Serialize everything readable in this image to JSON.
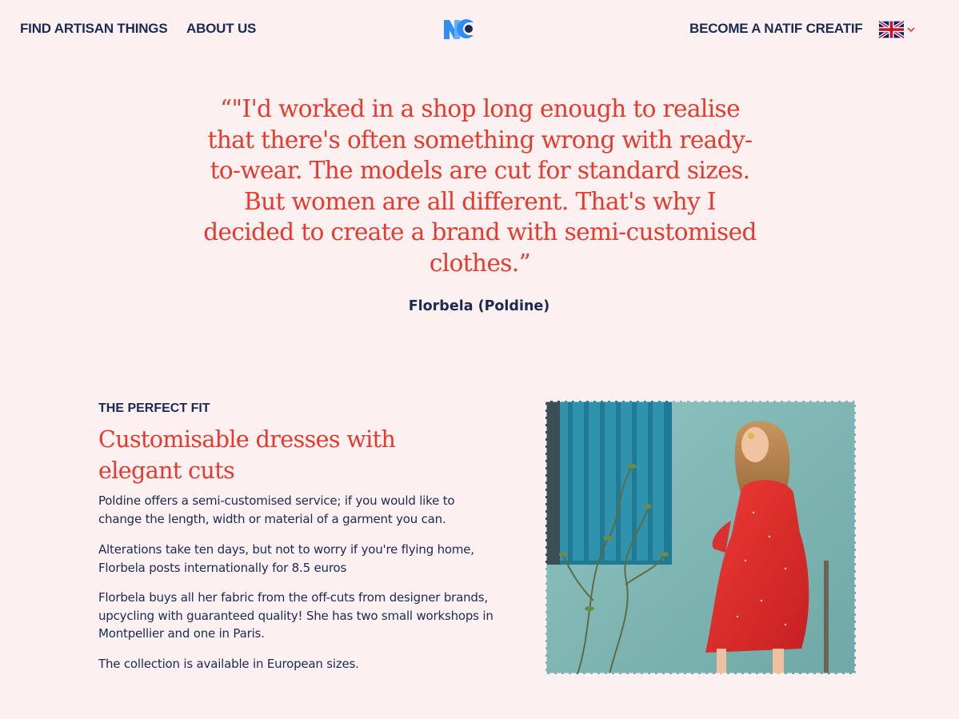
{
  "nav": {
    "find_label": "FIND ARTISAN THINGS",
    "about_label": "ABOUT US",
    "become_label": "BECOME A NATIF CREATIF",
    "language": "English"
  },
  "quote": {
    "text": "“\"I'd worked in a shop long enough to realise that there's often something wrong with ready-to-wear. The models are cut for standard sizes. But women are all different. That's why I decided to create a brand with semi-customised clothes.”",
    "author": "Florbela (Poldine)"
  },
  "feature": {
    "eyebrow": "THE PERFECT FIT",
    "heading": "Customisable dresses with elegant cuts",
    "paragraphs": [
      "Poldine offers a semi-customised service; if you would like to change the length, width or material of a garment you can.",
      "Alterations take ten days, but not to worry if you're flying home, Florbela posts internationally for 8.5 euros",
      "Florbela buys all her fabric from the off-cuts from designer brands, upcycling with guaranteed quality! She has two small workshops in Montpellier and one in Paris.",
      "The collection is available in European sizes."
    ]
  },
  "colors": {
    "background": "#fdf0f1",
    "navy": "#1a2a52",
    "accent_red": "#e83a2c",
    "logo_blue": "#2f8ff0"
  },
  "icons": {
    "logo": "natif-creatif-logo",
    "language": "uk-flag-icon",
    "dropdown": "chevron-down-icon"
  }
}
